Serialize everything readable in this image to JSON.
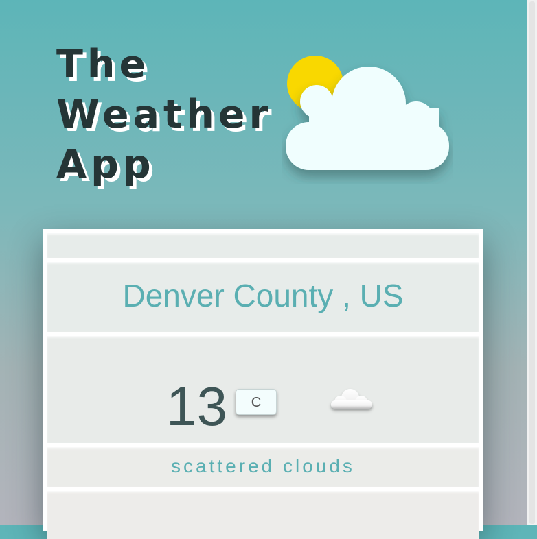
{
  "app": {
    "title_lines": [
      "The",
      "Weather",
      "App"
    ]
  },
  "weather": {
    "location": "Denver County , US",
    "temperature": "13",
    "unit_label": "C",
    "description": "scattered clouds",
    "condition_icon": "scattered-clouds-icon"
  },
  "colors": {
    "accent": "#5aafb2",
    "title": "#253536",
    "sun": "#f9d800",
    "cloud": "#f0fefe"
  }
}
